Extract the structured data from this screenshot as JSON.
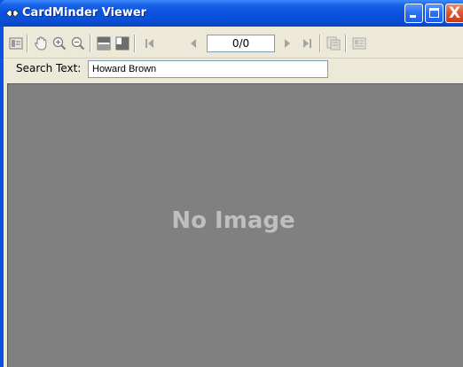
{
  "window": {
    "title": "CardMinder Viewer",
    "close_glyph": "X"
  },
  "toolbar": {
    "buttons": [
      {
        "name": "card-list-icon",
        "enabled": true
      },
      {
        "name": "hand-pan-icon",
        "enabled": true
      },
      {
        "name": "zoom-in-icon",
        "enabled": true
      },
      {
        "name": "zoom-out-icon",
        "enabled": true
      },
      {
        "name": "front-side-icon",
        "enabled": true
      },
      {
        "name": "back-side-icon",
        "enabled": true
      },
      {
        "name": "first-page-icon",
        "enabled": false
      },
      {
        "name": "previous-page-icon",
        "enabled": false
      },
      {
        "name": "next-page-icon",
        "enabled": false
      },
      {
        "name": "last-page-icon",
        "enabled": false
      },
      {
        "name": "copy-image-icon",
        "enabled": false
      },
      {
        "name": "edit-card-icon",
        "enabled": false
      }
    ],
    "page_indicator": "0/0"
  },
  "search": {
    "label": "Search Text:",
    "value": "Howard Brown"
  },
  "viewer": {
    "empty_text": "No Image"
  },
  "colors": {
    "titlebar": "#0a54e0",
    "client_bg": "#ece9d8",
    "viewer_bg": "#808080",
    "empty_text": "#bfbfbf",
    "close_button": "#e0522e"
  }
}
